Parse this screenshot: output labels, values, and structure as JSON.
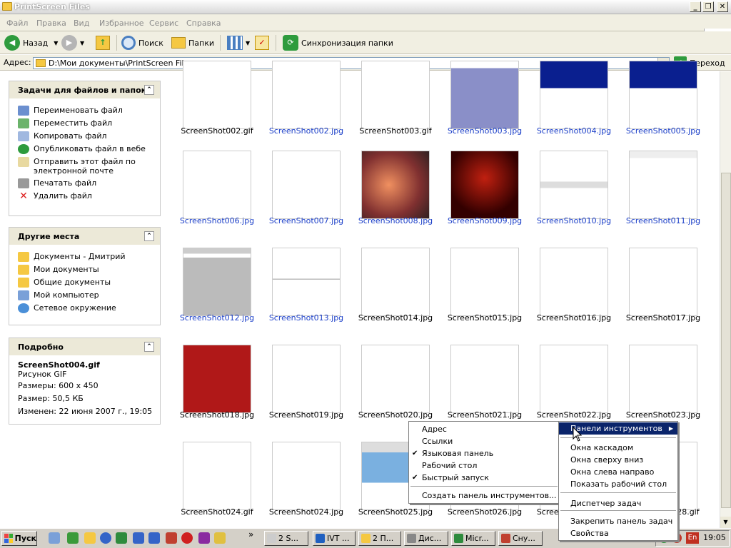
{
  "window": {
    "title": "PrintScreen Files"
  },
  "menubar": {
    "items": [
      "Файл",
      "Правка",
      "Вид",
      "Избранное",
      "Сервис",
      "Справка"
    ]
  },
  "toolbar": {
    "back": "Назад",
    "search": "Поиск",
    "folders": "Папки",
    "sync": "Синхронизация папки"
  },
  "address": {
    "label": "Адрес:",
    "value": "D:\\Мои документы\\PrintScreen Files",
    "go": "Переход"
  },
  "tasks": {
    "title": "Задачи для файлов и папок",
    "items": [
      {
        "label": "Переименовать файл",
        "icon": "rename-icon"
      },
      {
        "label": "Переместить файл",
        "icon": "move-icon"
      },
      {
        "label": "Копировать файл",
        "icon": "copy-icon"
      },
      {
        "label": "Опубликовать файл в вебе",
        "icon": "publish-icon"
      },
      {
        "label": "Отправить этот файл по электронной почте",
        "icon": "email-icon"
      },
      {
        "label": "Печатать файл",
        "icon": "print-icon"
      },
      {
        "label": "Удалить файл",
        "icon": "delete-icon"
      }
    ]
  },
  "places": {
    "title": "Другие места",
    "items": [
      {
        "label": "Документы - Дмитрий",
        "icon": "folder-icon"
      },
      {
        "label": "Мои документы",
        "icon": "documents-icon"
      },
      {
        "label": "Общие документы",
        "icon": "folder-icon"
      },
      {
        "label": "Мой компьютер",
        "icon": "computer-icon"
      },
      {
        "label": "Сетевое окружение",
        "icon": "network-icon"
      }
    ]
  },
  "details": {
    "title": "Подробно",
    "name": "ScreenShot004.gif",
    "type": "Рисунок GIF",
    "dimensions": "Размеры: 600 x 450",
    "size": "Размер: 50,5 КБ",
    "modified": "Изменен: 22 июня 2007 г., 19:05"
  },
  "files": [
    {
      "name": "ScreenShot002.gif",
      "jpg": false,
      "style": "shot"
    },
    {
      "name": "ScreenShot002.jpg",
      "jpg": true,
      "style": "purple"
    },
    {
      "name": "ScreenShot003.gif",
      "jpg": false,
      "style": "shot"
    },
    {
      "name": "ScreenShot003.jpg",
      "jpg": true,
      "style": "purple-dialog"
    },
    {
      "name": "ScreenShot004.jpg",
      "jpg": true,
      "style": "navy"
    },
    {
      "name": "ScreenShot005.jpg",
      "jpg": true,
      "style": "navy"
    },
    {
      "name": "ScreenShot006.jpg",
      "jpg": true,
      "style": "shot"
    },
    {
      "name": "ScreenShot007.jpg",
      "jpg": true,
      "style": "blank"
    },
    {
      "name": "ScreenShot008.jpg",
      "jpg": true,
      "style": "desktop"
    },
    {
      "name": "ScreenShot009.jpg",
      "jpg": true,
      "style": "game"
    },
    {
      "name": "ScreenShot010.jpg",
      "jpg": true,
      "style": "bar"
    },
    {
      "name": "ScreenShot011.jpg",
      "jpg": true,
      "style": "plot"
    },
    {
      "name": "ScreenShot012.jpg",
      "jpg": true,
      "style": "window"
    },
    {
      "name": "ScreenShot013.jpg",
      "jpg": true,
      "style": "line"
    },
    {
      "name": "ScreenShot014.jpg",
      "jpg": false,
      "style": "shot"
    },
    {
      "name": "ScreenShot015.jpg",
      "jpg": false,
      "style": "shot"
    },
    {
      "name": "ScreenShot016.jpg",
      "jpg": false,
      "style": "shot"
    },
    {
      "name": "ScreenShot017.jpg",
      "jpg": false,
      "style": "shot"
    },
    {
      "name": "ScreenShot018.jpg",
      "jpg": false,
      "style": "red"
    },
    {
      "name": "ScreenShot019.jpg",
      "jpg": false,
      "style": "table"
    },
    {
      "name": "ScreenShot020.jpg",
      "jpg": false,
      "style": "table"
    },
    {
      "name": "ScreenShot021.jpg",
      "jpg": false,
      "style": "table"
    },
    {
      "name": "ScreenShot022.jpg",
      "jpg": false,
      "style": "table"
    },
    {
      "name": "ScreenShot023.jpg",
      "jpg": false,
      "style": "shot"
    },
    {
      "name": "ScreenShot024.gif",
      "jpg": false,
      "style": "shot"
    },
    {
      "name": "ScreenShot024.jpg",
      "jpg": false,
      "style": "shot"
    },
    {
      "name": "ScreenShot025.jpg",
      "jpg": false,
      "style": "browser"
    },
    {
      "name": "ScreenShot026.jpg",
      "jpg": false,
      "style": "shot"
    },
    {
      "name": "ScreenShot027.jpg",
      "jpg": false,
      "style": "shot"
    },
    {
      "name": "ScreenShot028.gif",
      "jpg": false,
      "style": "shot"
    }
  ],
  "taskbar": {
    "start": "Пуск",
    "tasks": [
      {
        "label": "2 S...",
        "icon": "window-icon"
      },
      {
        "label": "IVT ...",
        "icon": "bluetooth-icon"
      },
      {
        "label": "2 П...",
        "icon": "folder-icon"
      },
      {
        "label": "Дис...",
        "icon": "disk-icon"
      },
      {
        "label": "Micr...",
        "icon": "excel-icon"
      },
      {
        "label": "Сну...",
        "icon": "app-icon"
      }
    ],
    "lang": "En",
    "time": "19:05"
  },
  "context_left": {
    "items": [
      {
        "label": "Адрес",
        "checked": false
      },
      {
        "label": "Ссылки",
        "checked": false
      },
      {
        "label": "Языковая панель",
        "checked": true
      },
      {
        "label": "Рабочий стол",
        "checked": false
      },
      {
        "label": "Быстрый запуск",
        "checked": true
      }
    ],
    "footer": "Создать панель инструментов..."
  },
  "context_right": {
    "items": [
      "Панели инструментов",
      "Окна каскадом",
      "Окна сверху вниз",
      "Окна слева направо",
      "Показать рабочий стол",
      "Диспетчер задач",
      "Закрепить панель задач",
      "Свойства"
    ]
  }
}
